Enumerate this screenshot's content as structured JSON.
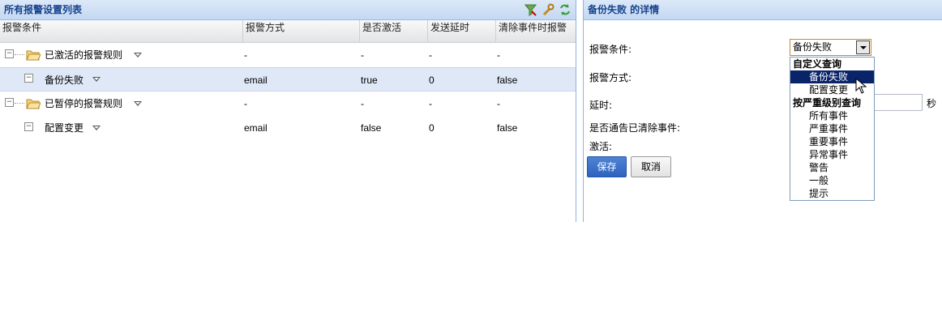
{
  "left_panel": {
    "title": "所有报警设置列表",
    "icons": [
      "filter-icon",
      "wrench-icon",
      "refresh-icon"
    ],
    "columns": [
      "报警条件",
      "报警方式",
      "是否激活",
      "发送延时",
      "清除事件时报警"
    ],
    "rows": [
      {
        "label": "已激活的报警规则",
        "method": "-",
        "active": "-",
        "delay": "-",
        "clear": "-"
      },
      {
        "label": "备份失败",
        "method": "email",
        "active": "true",
        "delay": "0",
        "clear": "false"
      },
      {
        "label": "已暂停的报警规则",
        "method": "-",
        "active": "-",
        "delay": "-",
        "clear": "-"
      },
      {
        "label": "配置变更",
        "method": "email",
        "active": "false",
        "delay": "0",
        "clear": "false"
      }
    ]
  },
  "right_panel": {
    "title": "备份失败 的详情",
    "labels": {
      "condition": "报警条件:",
      "method": "报警方式:",
      "delay": "延时:",
      "notify_cleared": "是否通告已清除事件:",
      "active": "激活:"
    },
    "condition_value": "备份失败",
    "seconds_unit": "秒",
    "dropdown": {
      "group1": "自定义查询",
      "group1_items": [
        "备份失败",
        "配置变更"
      ],
      "group2": "按严重级别查询",
      "group2_items": [
        "所有事件",
        "严重事件",
        "重要事件",
        "异常事件",
        "警告",
        "一般",
        "提示"
      ]
    },
    "buttons": {
      "save": "保存",
      "cancel": "取消"
    }
  },
  "colors": {
    "header_text": "#15428b",
    "selected_row": "#dfe8f6",
    "dropdown_highlight": "#0a246a",
    "primary_button": "#2d63c0"
  }
}
